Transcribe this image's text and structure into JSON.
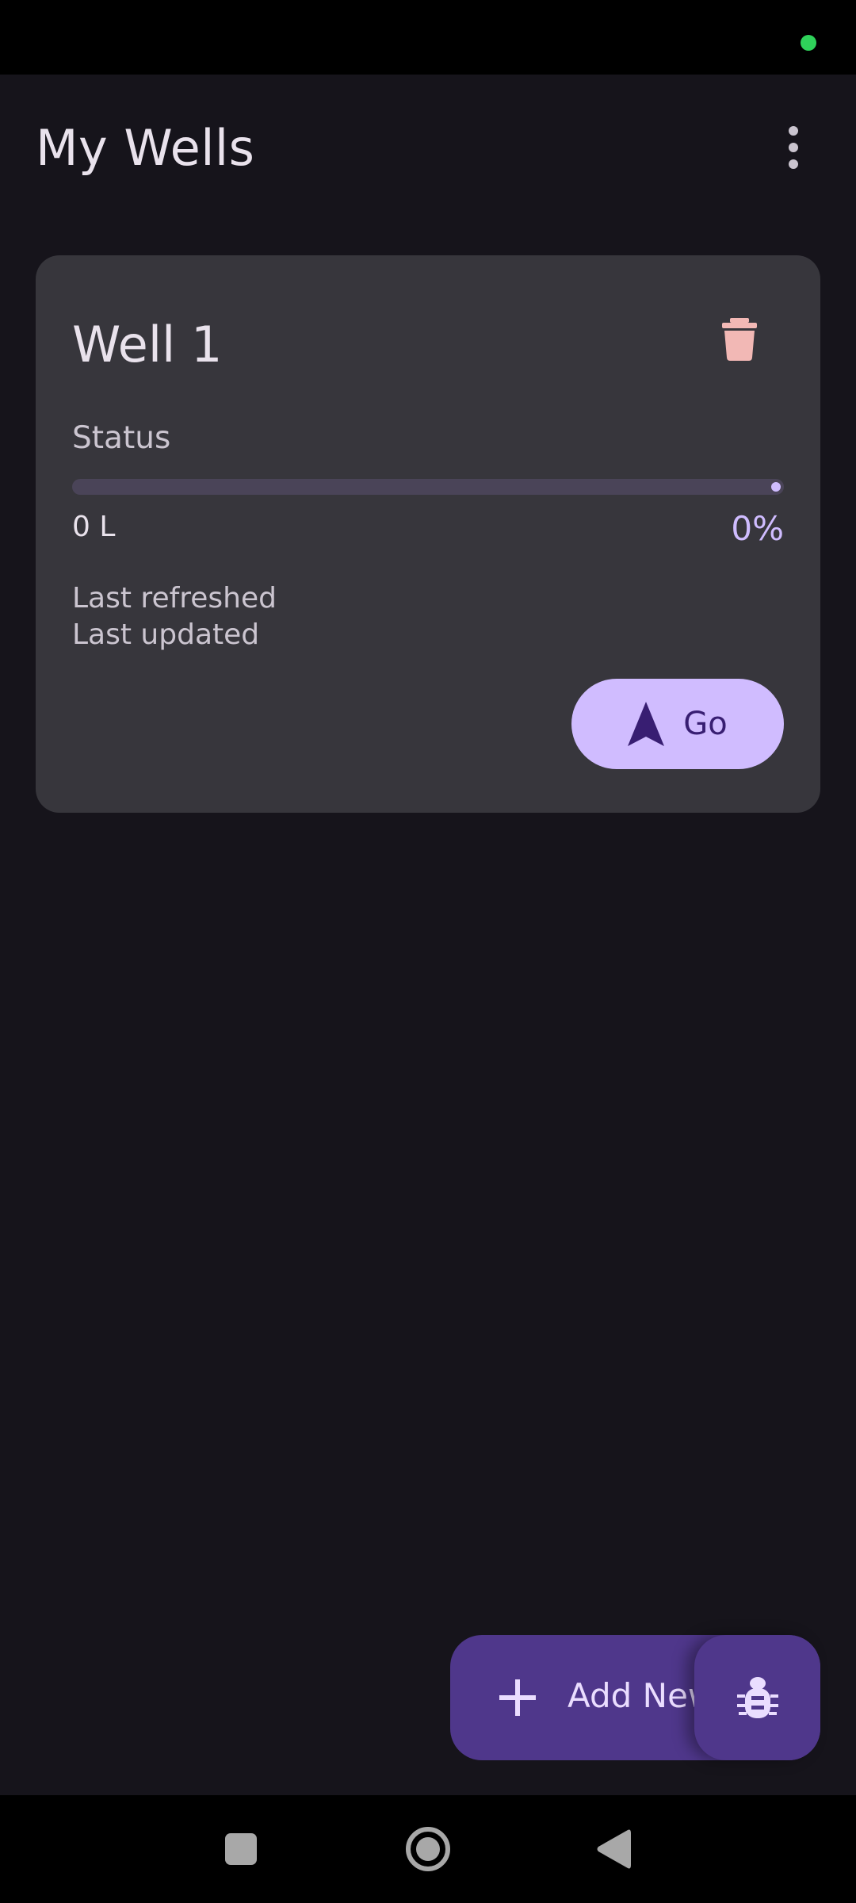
{
  "app_bar": {
    "title": "My Wells",
    "menu_icon": "more-vert-icon"
  },
  "wells": [
    {
      "name": "Well 1",
      "delete_icon": "trash-icon",
      "status_label": "Status",
      "volume": "0 L",
      "percent_text": "0%",
      "fill_fraction": 0,
      "last_refreshed": "Last refreshed",
      "last_updated": "Last updated",
      "go_label": "Go",
      "go_icon": "navigation-arrow-icon"
    }
  ],
  "fab": {
    "label": "Add New",
    "icon": "plus-icon"
  },
  "debug_fab": {
    "icon": "bug-icon"
  },
  "nav": {
    "recents_icon": "square-icon",
    "home_icon": "circle-home-icon",
    "back_icon": "triangle-back-icon"
  },
  "colors": {
    "background": "#16141b",
    "card": "#37363c",
    "accent": "#d0bcff",
    "fab": "#4f378b",
    "delete": "#f2b8b5"
  }
}
